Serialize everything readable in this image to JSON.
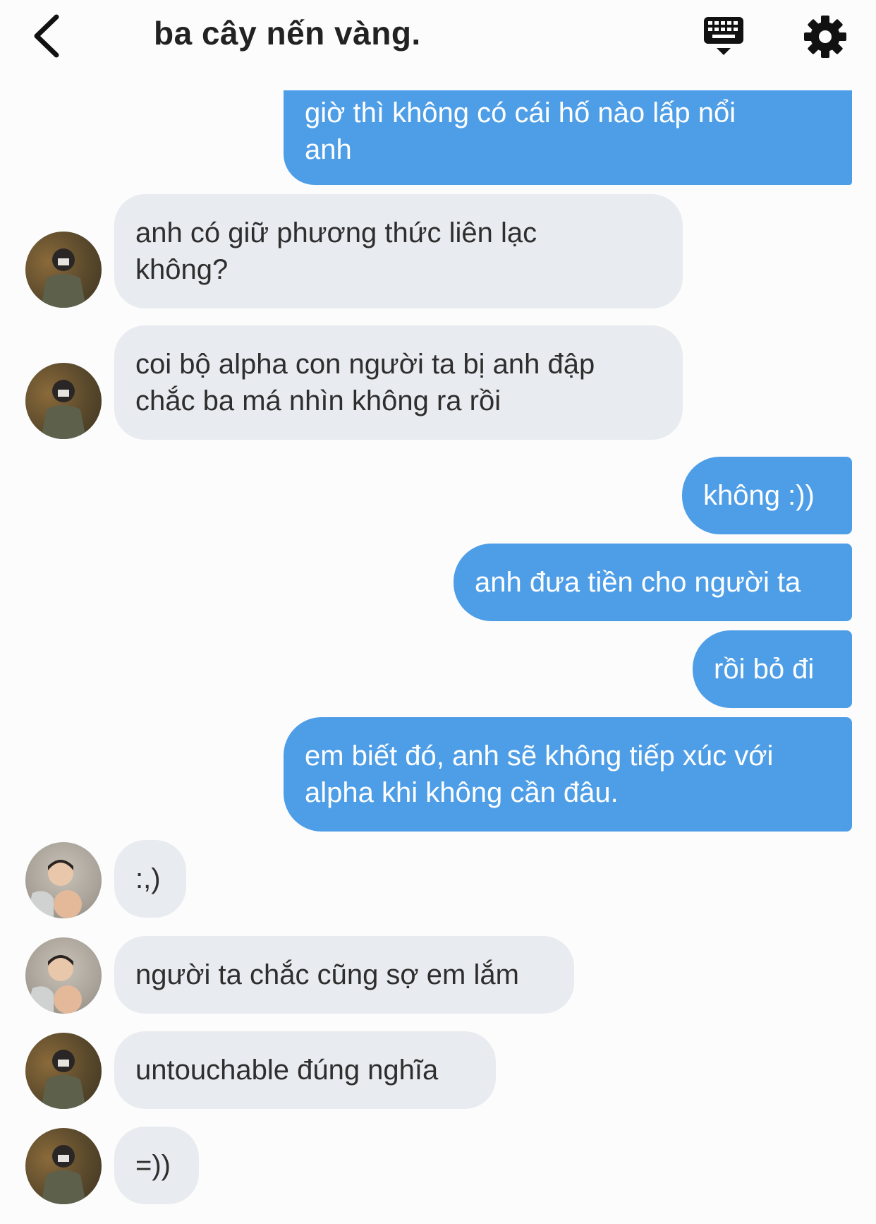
{
  "header": {
    "title": "ba cây nến vàng."
  },
  "messages": [
    {
      "text": "giờ thì không có cái hố nào lấp nổi\nanh"
    },
    {
      "text": "anh có giữ phương thức liên lạc\nkhông?"
    },
    {
      "text": "coi bộ alpha con người ta bị anh đập\nchắc ba má nhìn không ra rồi"
    },
    {
      "text": "không :))"
    },
    {
      "text": "anh đưa tiền cho người ta"
    },
    {
      "text": "rồi bỏ đi"
    },
    {
      "text": "em biết đó, anh sẽ không tiếp xúc với\nalpha khi không cần đâu."
    },
    {
      "text": ":,)"
    },
    {
      "text": "người ta chắc cũng sợ em lắm"
    },
    {
      "text": "untouchable đúng nghĩa"
    },
    {
      "text": "=))"
    }
  ]
}
